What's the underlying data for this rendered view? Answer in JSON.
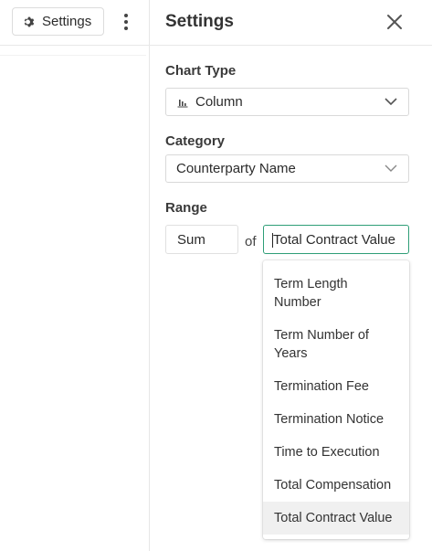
{
  "toolbar": {
    "settings_label": "Settings"
  },
  "panel": {
    "title": "Settings",
    "chart_type": {
      "label": "Chart Type",
      "value": "Column",
      "icon": "column-chart-icon"
    },
    "category": {
      "label": "Category",
      "value": "Counterparty Name"
    },
    "range": {
      "label": "Range",
      "aggregate": "Sum",
      "of_label": "of",
      "field_value": "Total Contract Value",
      "options": [
        {
          "line1": "Term Length",
          "line2": "Number"
        },
        {
          "line1": "Term Number of",
          "line2": "Years"
        },
        {
          "line1": "Termination Fee",
          "line2": ""
        },
        {
          "line1": "Termination Notice",
          "line2": ""
        },
        {
          "line1": "Time to Execution",
          "line2": ""
        },
        {
          "line1": "Total Compensation",
          "line2": ""
        },
        {
          "line1": "Total Contract Value",
          "line2": "",
          "selected": true
        }
      ]
    }
  },
  "colors": {
    "accent": "#2e9e77",
    "selected_option_bg": "#f0f0f0"
  }
}
